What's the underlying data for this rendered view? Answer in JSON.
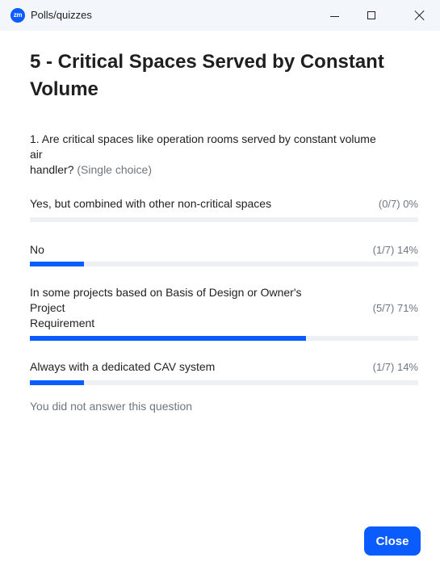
{
  "window": {
    "logo_text": "zm",
    "title": "Polls/quizzes"
  },
  "icons": {
    "minimize": "minimize-icon",
    "maximize": "maximize-icon",
    "close": "close-icon"
  },
  "colors": {
    "accent": "#0b5cff",
    "titlebar_bg": "#f3f6fb",
    "bar_track": "#eef0f3",
    "muted_text": "#6e7680"
  },
  "poll": {
    "title": "5 - Critical Spaces Served by Constant Volume",
    "question": {
      "lines": [
        "1. Are critical spaces like operation rooms served by constant volume",
        "air",
        "handler?"
      ],
      "type": "(Single choice)"
    },
    "options": [
      {
        "lines": [
          "Yes, but combined with other non-critical spaces"
        ],
        "result": "(0/7) 0%",
        "percent": 0
      },
      {
        "lines": [
          "No"
        ],
        "result": "(1/7) 14%",
        "percent": 14
      },
      {
        "lines": [
          "In some projects based on Basis of Design or Owner's",
          "Project",
          "Requirement"
        ],
        "result": "(5/7) 71%",
        "percent": 71
      },
      {
        "lines": [
          "Always with a dedicated CAV system"
        ],
        "result": "(1/7) 14%",
        "percent": 14
      }
    ],
    "status": "You did not answer this question"
  },
  "footer": {
    "close_label": "Close"
  }
}
